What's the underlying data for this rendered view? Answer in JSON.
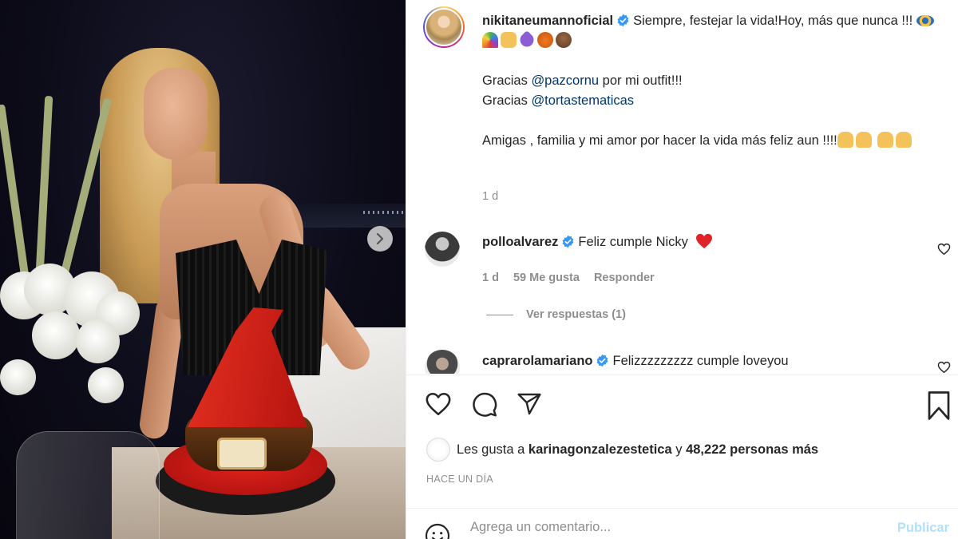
{
  "post": {
    "author": "nikitaneumannoficial",
    "caption_line1": "Siempre, festejar la vida!Hoy, más que nunca !!!",
    "caption_thanks1_prefix": "Gracias ",
    "caption_thanks1_mention": "@pazcornu",
    "caption_thanks1_suffix": " por mi outfit!!!",
    "caption_thanks2_prefix": "Gracias ",
    "caption_thanks2_mention": "@tortastematicas",
    "caption_line3": "Amigas , familia y mi amor por hacer la vida más feliz aun !!!!",
    "caption_time": "1 d"
  },
  "comments": [
    {
      "author": "polloalvarez",
      "text": "Feliz cumple Nicky",
      "time": "1 d",
      "likes": "59 Me gusta",
      "reply": "Responder",
      "view_replies": "Ver respuestas (1)"
    },
    {
      "author": "caprarolamariano",
      "text": "Felizzzzzzzzz cumple loveyou"
    }
  ],
  "likes": {
    "prefix": "Les gusta a ",
    "user": "karinagonzalezestetica",
    "middle": " y ",
    "count": "48,222",
    "suffix": " personas más"
  },
  "time_ago": "HACE UN DÍA",
  "comment_box": {
    "placeholder": "Agrega un comentario...",
    "publish": "Publicar"
  },
  "icons": [
    "heart-icon",
    "comment-icon",
    "share-icon",
    "bookmark-icon",
    "verified-icon",
    "emoji-icon",
    "chevron-right-icon"
  ],
  "colors": {
    "verified": "#3897f0",
    "link": "#00376b",
    "publish_disabled": "#b2dffc",
    "heart_red": "#ed4956"
  }
}
